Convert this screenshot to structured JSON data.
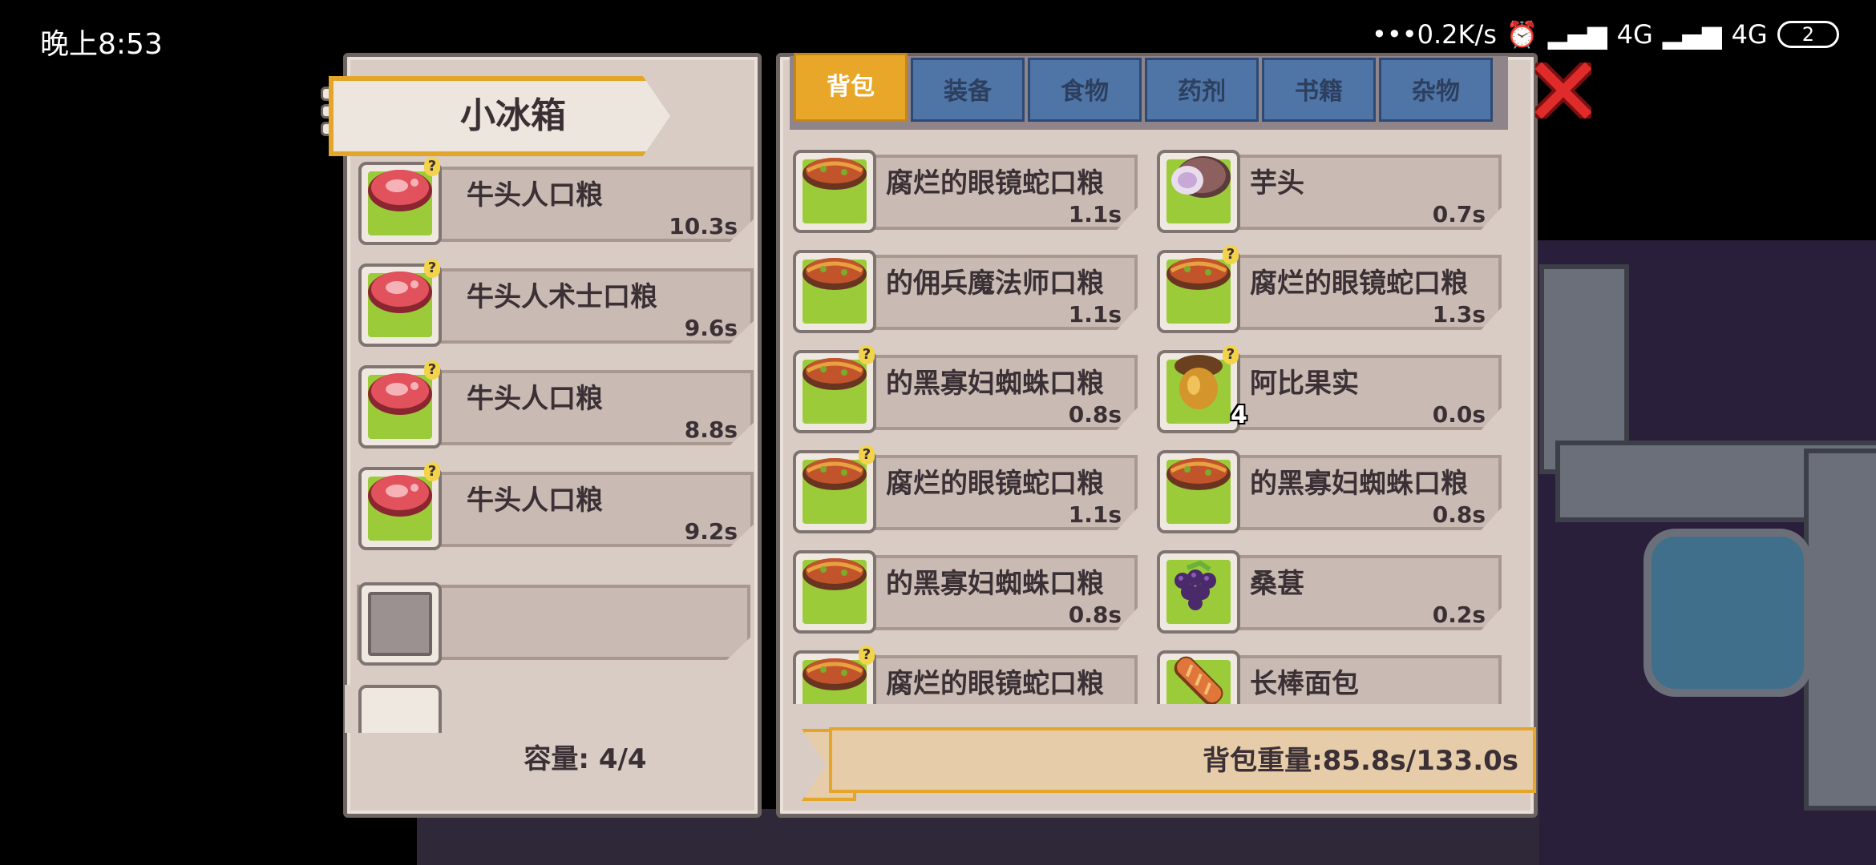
{
  "status_bar": {
    "time": "晚上8:53",
    "network_speed": "•••0.2K/s",
    "signal_1": "4G",
    "signal_2": "4G",
    "battery": "2",
    "icons": [
      "alarm-icon",
      "hd-signal-icon",
      "signal-icon",
      "signal-icon"
    ]
  },
  "fridge": {
    "title": "小冰箱",
    "items": [
      {
        "name": "牛头人口粮",
        "weight": "10.3s",
        "icon": "meat-icon",
        "unknown": true
      },
      {
        "name": "牛头人术士口粮",
        "weight": "9.6s",
        "icon": "meat-icon",
        "unknown": true
      },
      {
        "name": "牛头人口粮",
        "weight": "8.8s",
        "icon": "meat-icon",
        "unknown": true
      },
      {
        "name": "牛头人口粮",
        "weight": "9.2s",
        "icon": "meat-icon",
        "unknown": true
      }
    ],
    "capacity_label": "容量: 4/4"
  },
  "tabs": [
    {
      "label": "背包",
      "active": true
    },
    {
      "label": "装备",
      "active": false
    },
    {
      "label": "食物",
      "active": false
    },
    {
      "label": "药剂",
      "active": false
    },
    {
      "label": "书籍",
      "active": false
    },
    {
      "label": "杂物",
      "active": false
    }
  ],
  "backpack": {
    "items": [
      {
        "name": "腐烂的眼镜蛇口粮",
        "weight": "1.1s",
        "icon": "snake-meat-icon"
      },
      {
        "name": "芋头",
        "weight": "0.7s",
        "icon": "taro-icon"
      },
      {
        "name": "的佣兵魔法师口粮",
        "weight": "1.1s",
        "icon": "snake-meat-icon"
      },
      {
        "name": "腐烂的眼镜蛇口粮",
        "weight": "1.3s",
        "icon": "snake-meat-icon",
        "unknown": true
      },
      {
        "name": "的黑寡妇蜘蛛口粮",
        "weight": "0.8s",
        "icon": "snake-meat-icon",
        "unknown": true
      },
      {
        "name": "阿比果实",
        "weight": "0.0s",
        "icon": "acorn-icon",
        "unknown": true,
        "count": "4"
      },
      {
        "name": "腐烂的眼镜蛇口粮",
        "weight": "1.1s",
        "icon": "snake-meat-icon",
        "unknown": true
      },
      {
        "name": "的黑寡妇蜘蛛口粮",
        "weight": "0.8s",
        "icon": "snake-meat-icon"
      },
      {
        "name": "的黑寡妇蜘蛛口粮",
        "weight": "0.8s",
        "icon": "snake-meat-icon"
      },
      {
        "name": "桑葚",
        "weight": "0.2s",
        "icon": "mulberry-icon"
      },
      {
        "name": "腐烂的眼镜蛇口粮",
        "weight": "",
        "icon": "snake-meat-icon",
        "unknown": true
      },
      {
        "name": "长棒面包",
        "weight": "",
        "icon": "bread-icon"
      }
    ],
    "weight_label": "背包重量:85.8s/133.0s"
  },
  "colors": {
    "accent_orange": "#e8a729",
    "tab_blue": "#4f74a6",
    "panel_bg": "#d9ccc4",
    "close_red": "#e02b2b",
    "slot_green": "#9ccb3a"
  }
}
